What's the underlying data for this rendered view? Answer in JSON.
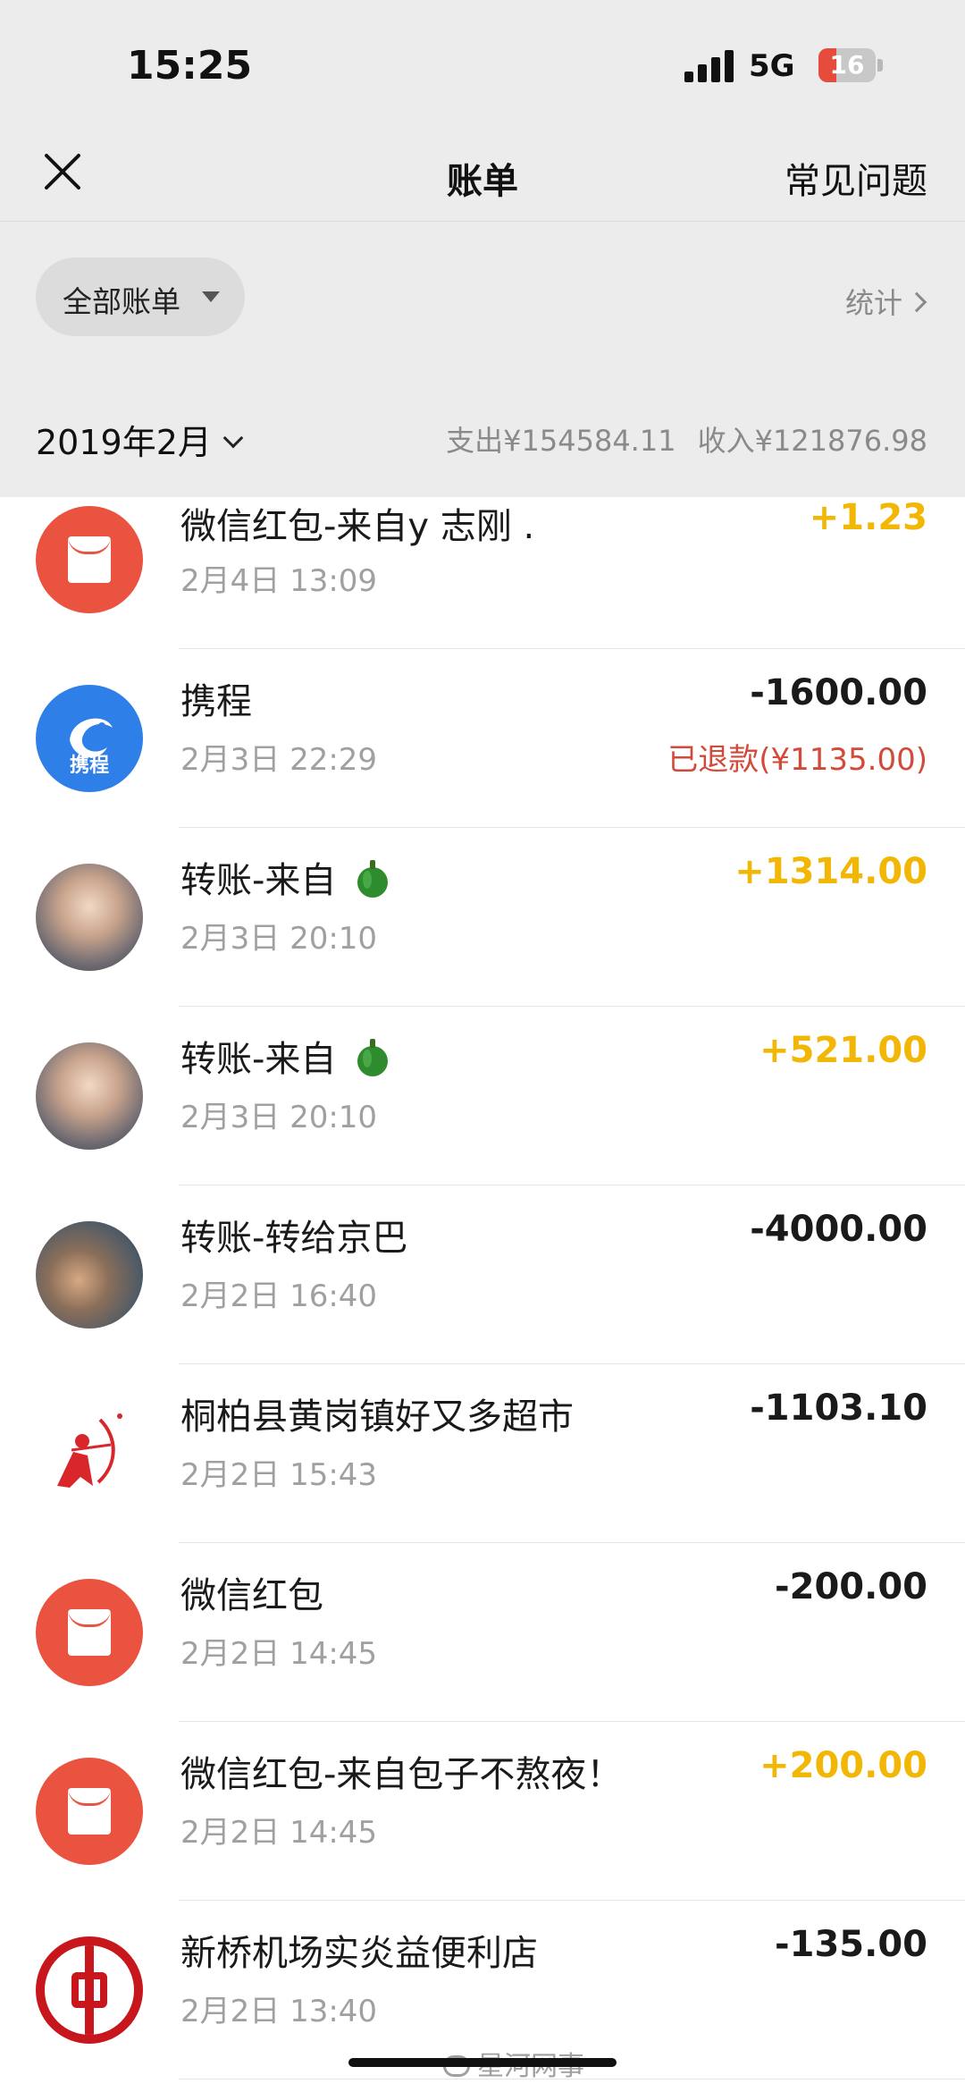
{
  "status_bar": {
    "time": "15:25",
    "network": "5G",
    "battery": "16",
    "battery_level_percent": 16
  },
  "nav": {
    "title": "账单",
    "faq_label": "常见问题"
  },
  "filter": {
    "label": "全部账单",
    "stats_label": "统计"
  },
  "month": {
    "label": "2019年2月",
    "expense": "支出¥154584.11",
    "income": "收入¥121876.98"
  },
  "transactions": [
    {
      "title": "微信红包-来自y 志刚 .",
      "time": "2月4日 13:09",
      "amount": "+1.23",
      "type": "income",
      "icon": "red-packet-icon"
    },
    {
      "title": "携程",
      "time": "2月3日 22:29",
      "amount": "-1600.00",
      "type": "expense",
      "note": "已退款(¥1135.00)",
      "icon": "ctrip-logo-icon",
      "icon_text": "携程"
    },
    {
      "title": "转账-来自",
      "time": "2月3日 20:10",
      "amount": "+1314.00",
      "type": "income",
      "icon": "avatar",
      "emoji": "green-pepper-icon"
    },
    {
      "title": "转账-来自",
      "time": "2月3日 20:10",
      "amount": "+521.00",
      "type": "income",
      "icon": "avatar",
      "emoji": "green-pepper-icon"
    },
    {
      "title": "转账-转给京巴",
      "time": "2月2日 16:40",
      "amount": "-4000.00",
      "type": "expense",
      "icon": "avatar"
    },
    {
      "title": "桐柏县黄岗镇好又多超市",
      "time": "2月2日 15:43",
      "amount": "-1103.10",
      "type": "expense",
      "icon": "archer-logo-icon"
    },
    {
      "title": "微信红包",
      "time": "2月2日 14:45",
      "amount": "-200.00",
      "type": "expense",
      "icon": "red-packet-icon"
    },
    {
      "title": "微信红包-来自包子不熬夜！",
      "time": "2月2日 14:45",
      "amount": "+200.00",
      "type": "income",
      "icon": "red-packet-icon"
    },
    {
      "title": "新桥机场实炎益便利店",
      "time": "2月2日 13:40",
      "amount": "-135.00",
      "type": "expense",
      "icon": "bank-of-china-logo-icon"
    }
  ],
  "watermark": "星河网事",
  "colors": {
    "income": "#f2b705",
    "refund_note": "#d24a3a",
    "red_packet": "#e9533f",
    "ctrip_blue": "#2f7fe8",
    "boc_red": "#c8161d",
    "header_bg": "#ececec"
  }
}
